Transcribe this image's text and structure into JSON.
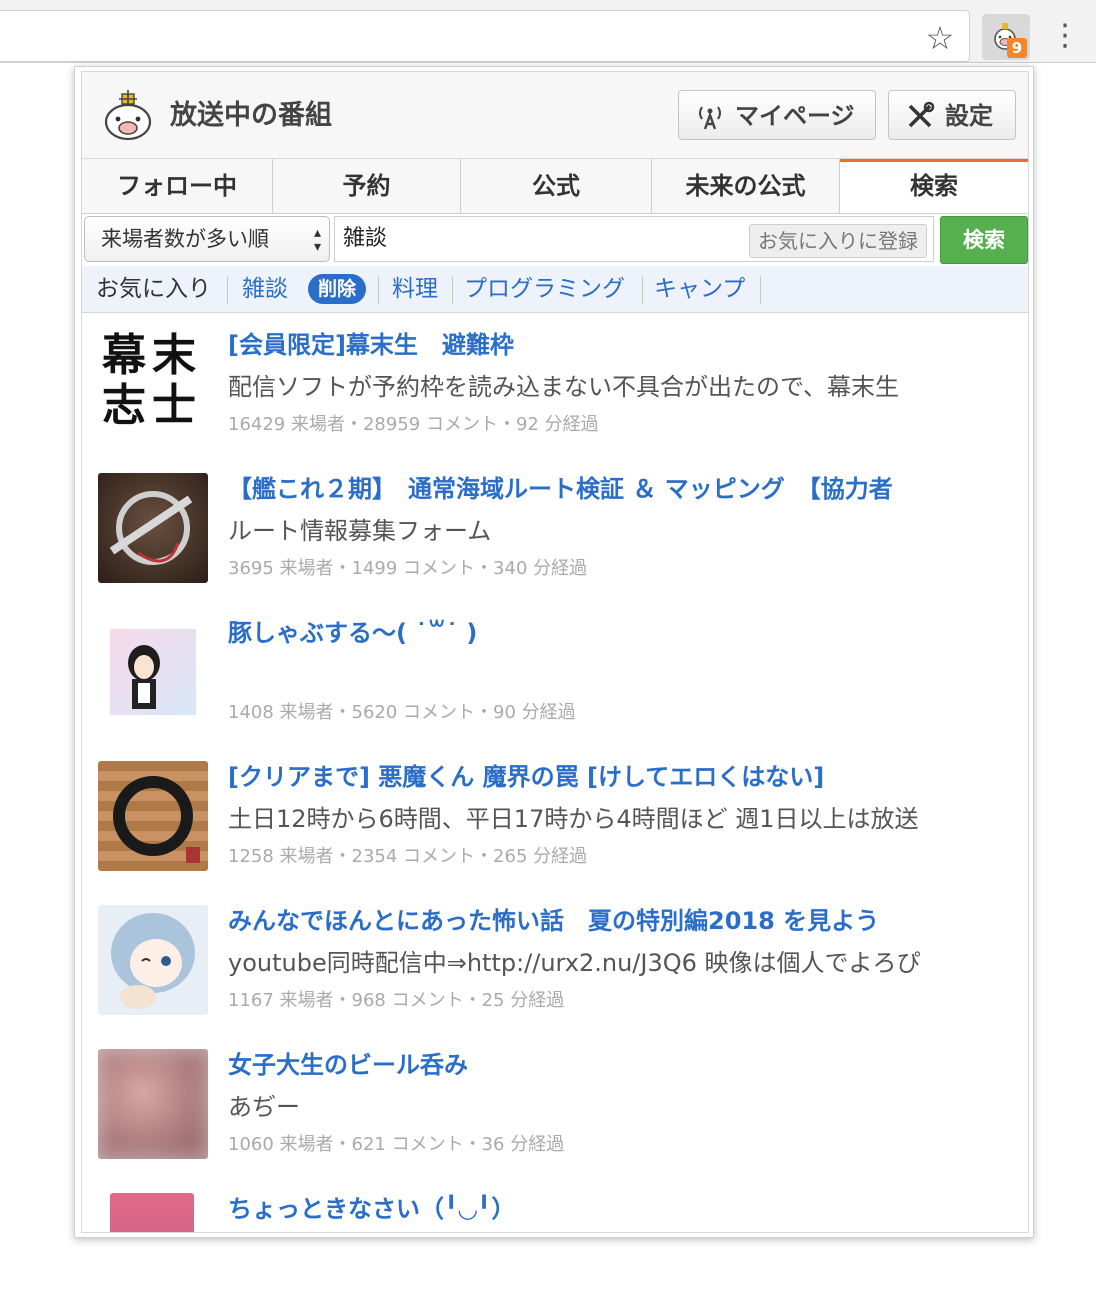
{
  "browser": {
    "star_icon": "star-outline-icon",
    "extension_badge": "9",
    "menu_icon": "kebab-icon"
  },
  "popup": {
    "title": "放送中の番組",
    "mypage_label": "マイページ",
    "settings_label": "設定",
    "tabs": [
      {
        "label": "フォロー中"
      },
      {
        "label": "予約"
      },
      {
        "label": "公式"
      },
      {
        "label": "未来の公式"
      },
      {
        "label": "検索"
      }
    ],
    "active_tab": "検索",
    "accent_color": "#e8712e",
    "link_color": "#2a6ec9",
    "sort_select": {
      "selected": "来場者数が多い順"
    },
    "search": {
      "value": "雑談",
      "favorite_register": "お気に入りに登録",
      "button": "検索"
    },
    "favorites": {
      "label": "お気に入り",
      "items": [
        "雑談",
        "料理",
        "プログラミング",
        "キャンプ"
      ],
      "delete_label": "削除"
    },
    "results": [
      {
        "title": "[会員限定]幕末生　避難枠",
        "desc": "配信ソフトが予約枠を読み込まない不具合が出たので、幕末生",
        "stats": "16429 来場者・28959 コメント・92 分経過",
        "thumb_text": "幕末志士"
      },
      {
        "title": "【艦これ２期】　通常海域ルート検証 ＆ マッピング　【協力者",
        "desc": "ルート情報募集フォーム",
        "stats": "3695 来場者・1499 コメント・340 分経過"
      },
      {
        "title": "豚しゃぶする〜( ˙꒳˙ )",
        "desc": "",
        "stats": "1408 来場者・5620 コメント・90 分経過"
      },
      {
        "title": "[クリアまで] 悪魔くん 魔界の罠 [けしてエロくはない]",
        "desc": "土日12時から6時間、平日17時から4時間ほど 週1日以上は放送",
        "stats": "1258 来場者・2354 コメント・265 分経過"
      },
      {
        "title": "みんなでほんとにあった怖い話　夏の特別編2018 を見よう",
        "desc": "youtube同時配信中⇒http://urx2.nu/J3Q6 映像は個人でよろぴ",
        "stats": "1167 来場者・968 コメント・25 分経過"
      },
      {
        "title": "女子大生のビール呑み",
        "desc": "あぢー",
        "stats": "1060 来場者・621 コメント・36 分経過"
      },
      {
        "title": "ちょっときなさい（╹◡╹）",
        "desc": "",
        "stats": ""
      }
    ]
  }
}
